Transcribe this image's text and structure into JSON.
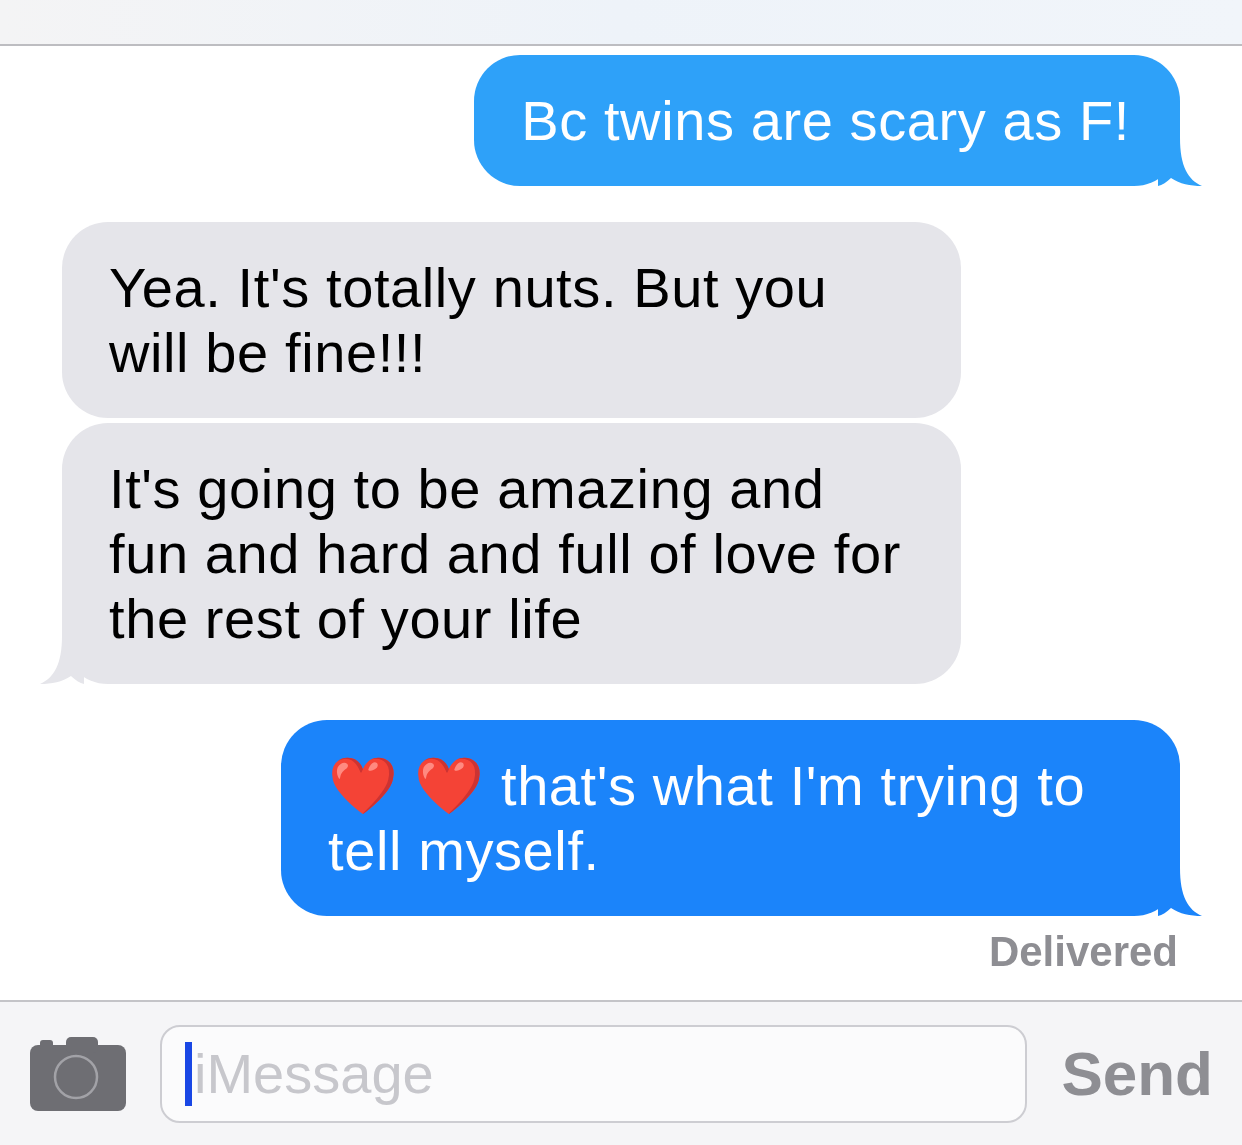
{
  "messages": [
    {
      "outgoing": true,
      "color": "#2ea1f9",
      "tail": true,
      "text": "Bc twins are scary as F!"
    },
    {
      "outgoing": false,
      "color": "#e5e5ea",
      "tail": false,
      "text": "Yea. It's totally nuts. But you will be fine!!!"
    },
    {
      "outgoing": false,
      "color": "#e5e5ea",
      "tail": true,
      "text": "It's going to be amazing and fun and hard and full of love for the rest of your life"
    },
    {
      "outgoing": true,
      "color": "#1b84fa",
      "tail": true,
      "text": "❤️ ❤️ that's what I'm trying to tell myself."
    }
  ],
  "status": "Delivered",
  "composer": {
    "placeholder": "iMessage",
    "send_button": {
      "label": "Send",
      "disabled": true
    }
  }
}
